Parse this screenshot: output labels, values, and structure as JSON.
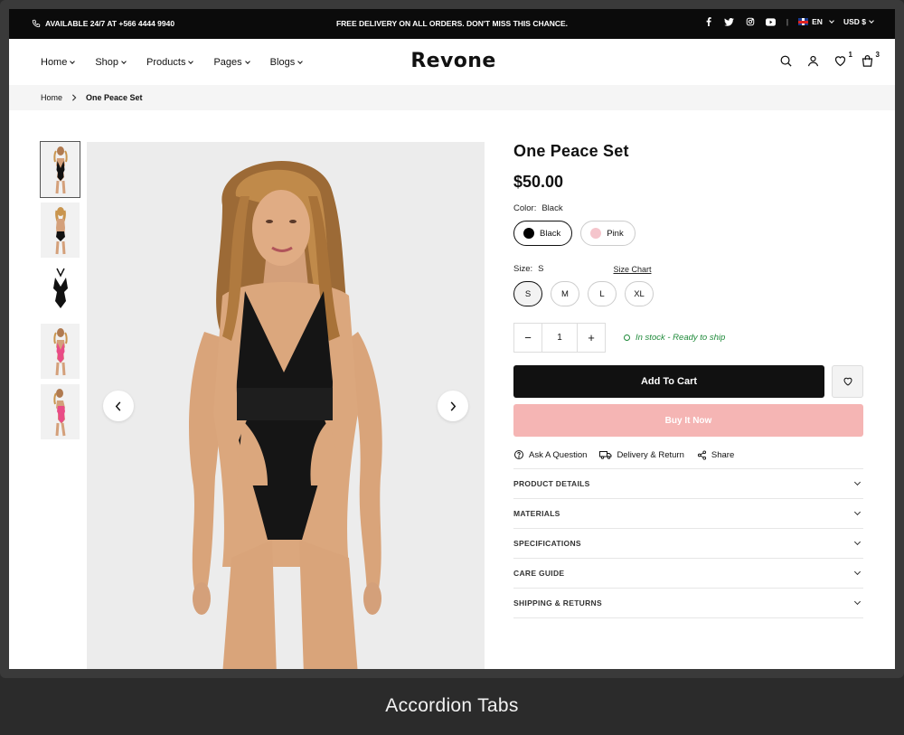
{
  "topbar": {
    "phone_text": "AVAILABLE 24/7 AT +566 4444 9940",
    "promo_text": "FREE DELIVERY ON ALL ORDERS. DON'T MISS THIS CHANCE.",
    "social_icons": [
      "facebook-icon",
      "twitter-icon",
      "instagram-icon",
      "youtube-icon"
    ],
    "separator": "|",
    "language": "EN",
    "currency": "USD $"
  },
  "header": {
    "logo": "Revone",
    "nav": [
      {
        "label": "Home"
      },
      {
        "label": "Shop"
      },
      {
        "label": "Products"
      },
      {
        "label": "Pages"
      },
      {
        "label": "Blogs"
      }
    ],
    "wishlist_count": "1",
    "cart_count": "3"
  },
  "breadcrumb": {
    "home": "Home",
    "current": "One Peace Set"
  },
  "gallery": {
    "thumbnails": [
      "black-front",
      "black-back",
      "black-flat",
      "pink-front",
      "pink-side"
    ],
    "active_index": 0
  },
  "product": {
    "title": "One Peace Set",
    "price": "$50.00",
    "color_label": "Color:",
    "color_selected": "Black",
    "colors": [
      {
        "name": "Black",
        "hex": "#000000"
      },
      {
        "name": "Pink",
        "hex": "#f5c5cc"
      }
    ],
    "size_label": "Size:",
    "size_selected": "S",
    "size_chart_label": "Size Chart",
    "sizes": [
      "S",
      "M",
      "L",
      "XL"
    ],
    "quantity": "1",
    "minus": "−",
    "plus": "+",
    "stock_text": "In stock - Ready to ship",
    "add_to_cart": "Add To Cart",
    "buy_now": "Buy It Now",
    "ask_question": "Ask A Question",
    "delivery_return": "Delivery & Return",
    "share": "Share"
  },
  "accordion": [
    {
      "label": "PRODUCT DETAILS"
    },
    {
      "label": "MATERIALS"
    },
    {
      "label": "SPECIFICATIONS"
    },
    {
      "label": "CARE GUIDE"
    },
    {
      "label": "SHIPPING & RETURNS"
    }
  ],
  "colors": {
    "topbar_bg": "#0b0b0b",
    "add_to_cart_bg": "#111111",
    "buy_now_bg": "#f5b5b4",
    "stock_green": "#1f8a3a"
  },
  "caption": "Accordion Tabs"
}
